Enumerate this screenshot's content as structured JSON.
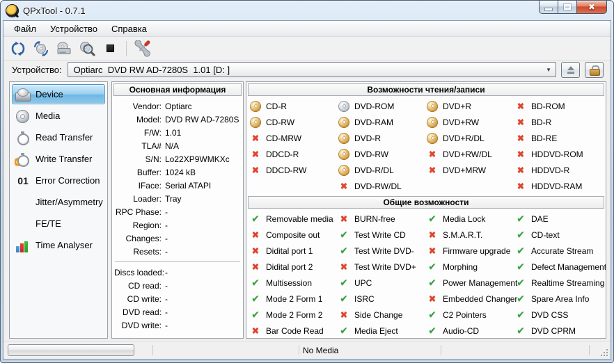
{
  "window": {
    "title": "QPxTool - 0.7.1"
  },
  "menu": {
    "items": [
      {
        "label": "Файл",
        "name": "menu-file"
      },
      {
        "label": "Устройство",
        "name": "menu-device"
      },
      {
        "label": "Справка",
        "name": "menu-help"
      }
    ]
  },
  "toolbar": {
    "buttons": [
      "refresh-devices-icon",
      "refresh-media-icon",
      "drive-icon",
      "scan-media-icon",
      "stop-icon",
      "preferences-tools-icon"
    ]
  },
  "device_bar": {
    "label": "Устройство:",
    "value": "Optiarc  DVD RW AD-7280S  1.01 [D: ]"
  },
  "sidebar": {
    "items": [
      {
        "label": "Device",
        "icon": "drive",
        "selected": true
      },
      {
        "label": "Media",
        "icon": "cd"
      },
      {
        "label": "Read Transfer",
        "icon": "stopwatch"
      },
      {
        "label": "Write Transfer",
        "icon": "stopwatch-fire"
      },
      {
        "label": "Error Correction",
        "icon": "digits-01"
      },
      {
        "label": "Jitter/Asymmetry",
        "icon": "blank"
      },
      {
        "label": "FE/TE",
        "icon": "blank"
      },
      {
        "label": "Time Analyser",
        "icon": "bar-chart"
      }
    ]
  },
  "info": {
    "title": "Основная информация",
    "rows": [
      {
        "label": "Vendor:",
        "value": "Optiarc"
      },
      {
        "label": "Model:",
        "value": "DVD RW AD-7280S"
      },
      {
        "label": "F/W:",
        "value": "1.01"
      },
      {
        "label": "TLA#",
        "value": "N/A"
      },
      {
        "label": "S/N:",
        "value": "Lo22XP9WMKXc"
      },
      {
        "label": "Buffer:",
        "value": "1024 kB"
      },
      {
        "label": "IFace:",
        "value": "Serial ATAPI"
      },
      {
        "label": "Loader:",
        "value": "Tray"
      },
      {
        "label": "RPC Phase:",
        "value": "-"
      },
      {
        "label": "Region:",
        "value": "-"
      },
      {
        "label": "Changes:",
        "value": "-"
      },
      {
        "label": "Resets:",
        "value": "-"
      }
    ],
    "rows2": [
      {
        "label": "Discs loaded:",
        "value": "-"
      },
      {
        "label": "CD read:",
        "value": "-"
      },
      {
        "label": "CD write:",
        "value": "-"
      },
      {
        "label": "DVD read:",
        "value": "-"
      },
      {
        "label": "DVD write:",
        "value": "-"
      }
    ]
  },
  "capabilities": {
    "title": "Возможности чтения/записи",
    "col1": [
      {
        "label": "CD-R",
        "state": "disc-gold"
      },
      {
        "label": "CD-RW",
        "state": "disc-gold"
      },
      {
        "label": "CD-MRW",
        "state": "cross"
      },
      {
        "label": "DDCD-R",
        "state": "cross"
      },
      {
        "label": "DDCD-RW",
        "state": "cross"
      }
    ],
    "col2": [
      {
        "label": "DVD-ROM",
        "state": "disc-silver"
      },
      {
        "label": "DVD-RAM",
        "state": "disc-gold"
      },
      {
        "label": "DVD-R",
        "state": "disc-gold"
      },
      {
        "label": "DVD-RW",
        "state": "disc-gold"
      },
      {
        "label": "DVD-R/DL",
        "state": "disc-gold"
      },
      {
        "label": "DVD-RW/DL",
        "state": "cross"
      }
    ],
    "col3": [
      {
        "label": "DVD+R",
        "state": "disc-gold"
      },
      {
        "label": "DVD+RW",
        "state": "disc-gold"
      },
      {
        "label": "DVD+R/DL",
        "state": "disc-gold"
      },
      {
        "label": "DVD+RW/DL",
        "state": "cross"
      },
      {
        "label": "DVD+MRW",
        "state": "cross"
      }
    ],
    "col4": [
      {
        "label": "BD-ROM",
        "state": "cross"
      },
      {
        "label": "BD-R",
        "state": "cross"
      },
      {
        "label": "BD-RE",
        "state": "cross"
      },
      {
        "label": "HDDVD-ROM",
        "state": "cross"
      },
      {
        "label": "HDDVD-R",
        "state": "cross"
      },
      {
        "label": "HDDVD-RAM",
        "state": "cross"
      }
    ]
  },
  "general": {
    "title": "Общие возможности",
    "col1": [
      {
        "label": "Removable media",
        "state": "check"
      },
      {
        "label": "Composite out",
        "state": "cross"
      },
      {
        "label": "Didital port 1",
        "state": "cross"
      },
      {
        "label": "Didital port 2",
        "state": "cross"
      },
      {
        "label": "Multisession",
        "state": "check"
      },
      {
        "label": "Mode 2 Form 1",
        "state": "check"
      },
      {
        "label": "Mode 2 Form 2",
        "state": "check"
      },
      {
        "label": "Bar Code Read",
        "state": "cross"
      }
    ],
    "col2": [
      {
        "label": "BURN-free",
        "state": "cross"
      },
      {
        "label": "Test Write CD",
        "state": "check"
      },
      {
        "label": "Test Write DVD-",
        "state": "check"
      },
      {
        "label": "Test Write DVD+",
        "state": "cross"
      },
      {
        "label": "UPC",
        "state": "check"
      },
      {
        "label": "ISRC",
        "state": "check"
      },
      {
        "label": "Side Change",
        "state": "cross"
      },
      {
        "label": "Media Eject",
        "state": "check"
      }
    ],
    "col3": [
      {
        "label": "Media Lock",
        "state": "check"
      },
      {
        "label": "S.M.A.R.T.",
        "state": "cross"
      },
      {
        "label": "Firmware upgrade",
        "state": "cross"
      },
      {
        "label": "Morphing",
        "state": "check"
      },
      {
        "label": "Power Management",
        "state": "check"
      },
      {
        "label": "Embedded Changer",
        "state": "cross"
      },
      {
        "label": "C2 Pointers",
        "state": "check"
      },
      {
        "label": "Audio-CD",
        "state": "check"
      }
    ],
    "col4": [
      {
        "label": "DAE",
        "state": "check"
      },
      {
        "label": "CD-text",
        "state": "check"
      },
      {
        "label": "Accurate Stream",
        "state": "check"
      },
      {
        "label": "Defect Management",
        "state": "check"
      },
      {
        "label": "Realtime Streaming",
        "state": "check"
      },
      {
        "label": "Spare Area Info",
        "state": "check"
      },
      {
        "label": "DVD CSS",
        "state": "check"
      },
      {
        "label": "DVD CPRM",
        "state": "check"
      }
    ]
  },
  "status": {
    "message": "No Media"
  },
  "colors": {
    "selected_item": "#7fc0e8",
    "check": "#2fa535",
    "cross": "#e2432c",
    "disc_gold": "#dfae55",
    "disc_silver": "#c3c8cf",
    "close_button": "#cf4a2c",
    "frame": "#b6cbe1"
  }
}
